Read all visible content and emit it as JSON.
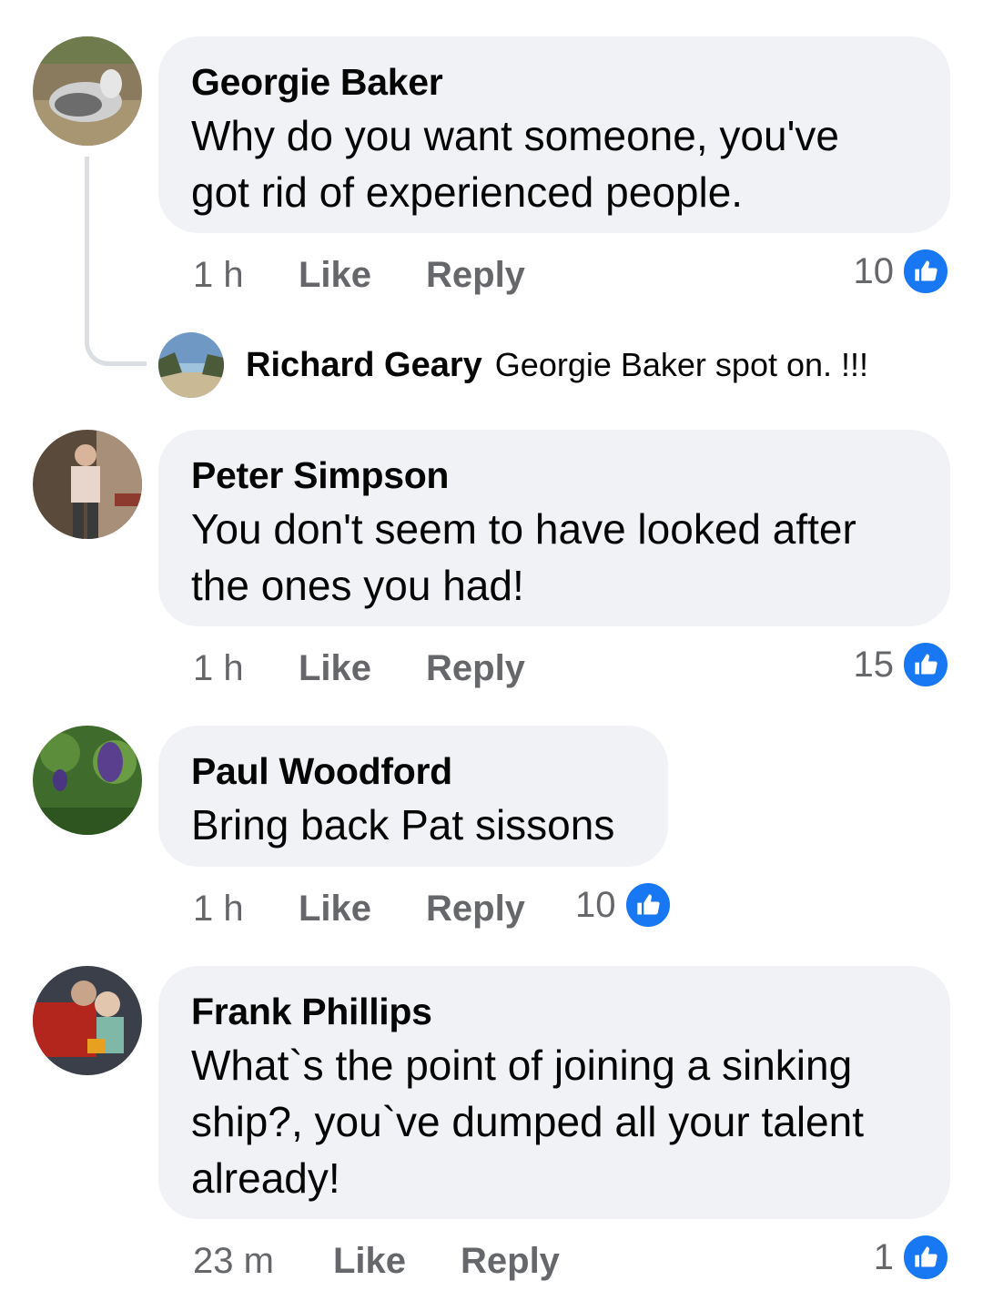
{
  "comments": [
    {
      "author": "Georgie Baker",
      "lines": [
        "Why do you want someone, you've",
        "got rid of experienced people."
      ],
      "time": "1 h",
      "like_label": "Like",
      "reply_label": "Reply",
      "reaction_count": "10",
      "reply": {
        "author": "Richard Geary",
        "text": "Georgie Baker spot on. !!!"
      }
    },
    {
      "author": "Peter Simpson",
      "lines": [
        "You don't seem to have looked after",
        "the ones you had!"
      ],
      "time": "1 h",
      "like_label": "Like",
      "reply_label": "Reply",
      "reaction_count": "15"
    },
    {
      "author": "Paul Woodford",
      "lines": [
        "Bring back Pat sissons"
      ],
      "time": "1 h",
      "like_label": "Like",
      "reply_label": "Reply",
      "reaction_count": "10"
    },
    {
      "author": "Frank Phillips",
      "lines": [
        "What`s the point of joining a sinking",
        "ship?, you`ve dumped all your talent",
        "already!"
      ],
      "time": "23 m",
      "like_label": "Like",
      "reply_label": "Reply",
      "reaction_count": "1"
    }
  ],
  "icons": {
    "reaction": "like-thumb-icon"
  },
  "colors": {
    "bubble": "#f0f2f5",
    "meta_text": "#65676b",
    "like_blue": "#1877f2"
  }
}
